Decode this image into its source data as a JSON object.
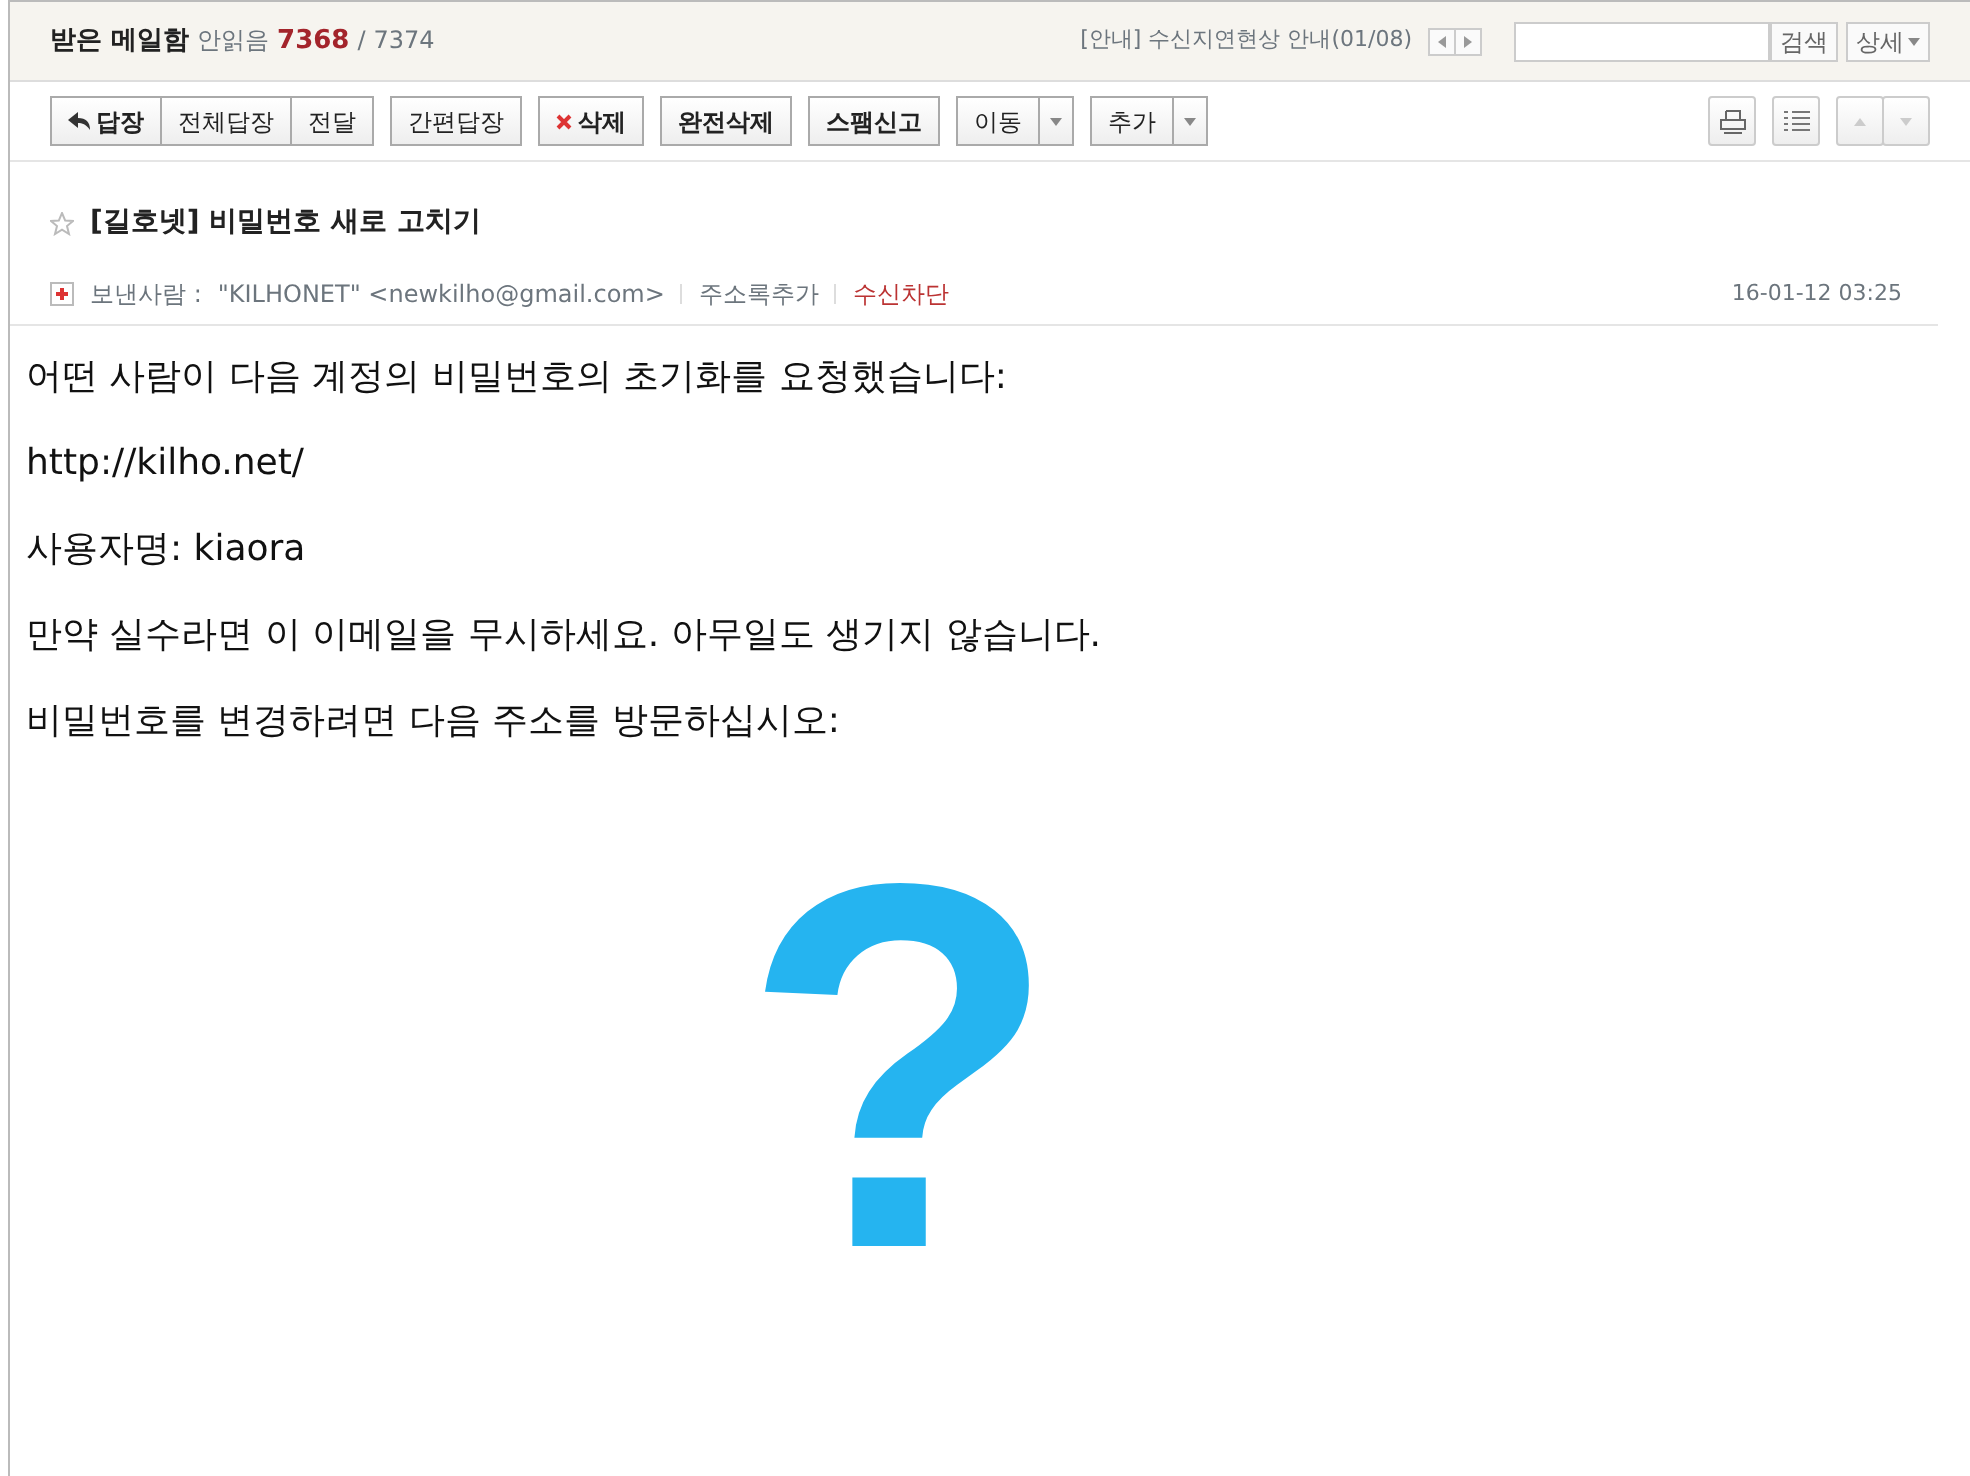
{
  "header": {
    "folder": "받은 메일함",
    "unread_label": "안읽음",
    "unread": "7368",
    "separator": "/",
    "total": "7374",
    "notice": "[안내] 수신지연현상 안내(01/08)",
    "search": {
      "button": "검색",
      "detail": "상세"
    }
  },
  "toolbar": [
    [
      {
        "label": "답장",
        "kind": "reply",
        "bold": true
      },
      {
        "label": "전체답장",
        "kind": "plain",
        "bold": false
      },
      {
        "label": "전달",
        "kind": "plain",
        "bold": false
      }
    ],
    [
      {
        "label": "간편답장",
        "kind": "plain",
        "bold": false
      }
    ],
    [
      {
        "label": "삭제",
        "kind": "delete",
        "bold": true
      }
    ],
    [
      {
        "label": "완전삭제",
        "kind": "plain",
        "bold": true
      }
    ],
    [
      {
        "label": "스팸신고",
        "kind": "plain",
        "bold": true
      }
    ],
    [
      {
        "label": "이동",
        "kind": "plain",
        "bold": false,
        "dropdown": true
      }
    ],
    [
      {
        "label": "추가",
        "kind": "plain",
        "bold": false,
        "dropdown": true
      }
    ]
  ],
  "message": {
    "starred": false,
    "subject": "[길호넷] 비밀번호 새로 고치기",
    "sender_label": "보낸사람 :",
    "sender": "\"KILHONET\" <newkilho@gmail.com>",
    "add_contact": "주소록추가",
    "block": "수신차단",
    "date": "16-01-12 03:25",
    "body": [
      "어떤 사람이 다음 계정의 비밀번호의 초기화를 요청했습니다:",
      "http://kilho.net/",
      "사용자명: kiaora",
      "만약 실수라면 이 이메일을 무시하세요. 아무일도 생기지 않습니다.",
      "비밀번호를 변경하려면 다음 주소를 방문하십시오:"
    ],
    "image_placeholder": "?"
  }
}
